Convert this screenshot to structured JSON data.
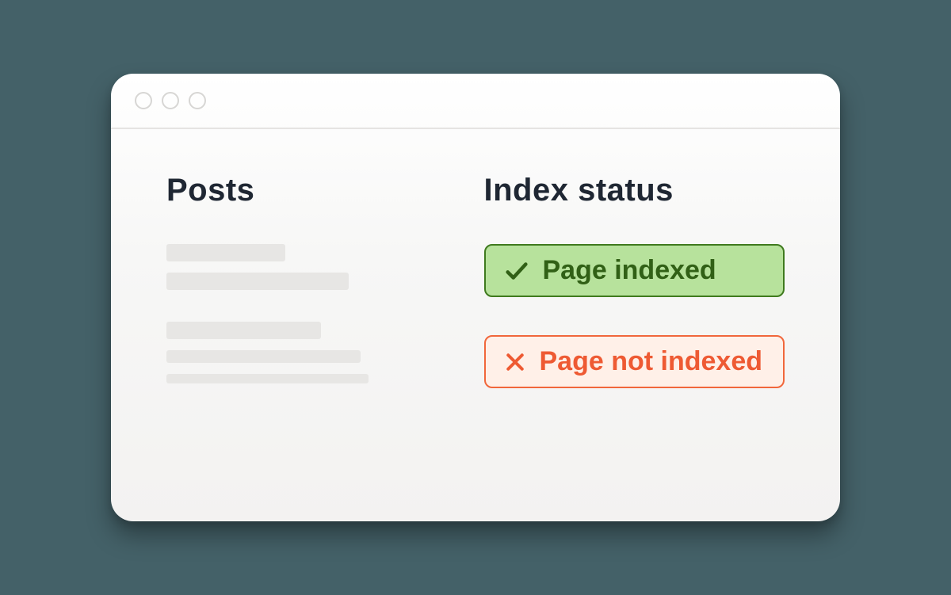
{
  "columns": {
    "posts_header": "Posts",
    "status_header": "Index status"
  },
  "statuses": {
    "indexed_label": "Page indexed",
    "not_indexed_label": "Page not indexed"
  },
  "colors": {
    "indexed_bg": "#b7e29c",
    "indexed_border": "#3f7a1e",
    "not_indexed_bg": "#fff0e8",
    "not_indexed_border": "#f1673b"
  }
}
